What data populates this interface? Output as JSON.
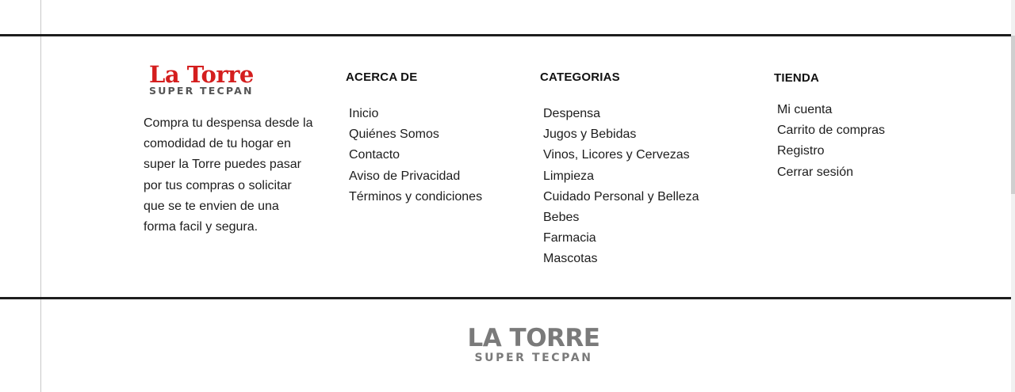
{
  "brand": {
    "logo_name": "La Torre",
    "logo_sub": "SUPER TECPAN",
    "logo_name_color": "#d41e1e",
    "description": "Compra tu despensa desde la comodidad de tu hogar en super la Torre puedes pasar por tus compras o solicitar que se te envien de una forma facil y segura."
  },
  "about": {
    "title": "ACERCA DE",
    "links": [
      "Inicio",
      "Quiénes Somos",
      "Contacto",
      "Aviso de Privacidad",
      "Términos y condiciones"
    ]
  },
  "categories": {
    "title": "CATEGORIAS",
    "links": [
      "Despensa",
      "Jugos y Bebidas",
      "Vinos, Licores y Cervezas",
      "Limpieza",
      "Cuidado Personal y Belleza",
      "Bebes",
      "Farmacia",
      "Mascotas"
    ]
  },
  "store": {
    "title": "TIENDA",
    "links": [
      "Mi cuenta",
      "Carrito de compras",
      "Registro",
      "Cerrar sesión"
    ]
  },
  "bottom_logo": {
    "name": "LA TORRE",
    "sub": "SUPER TECPAN",
    "color": "#7a7a7a"
  }
}
